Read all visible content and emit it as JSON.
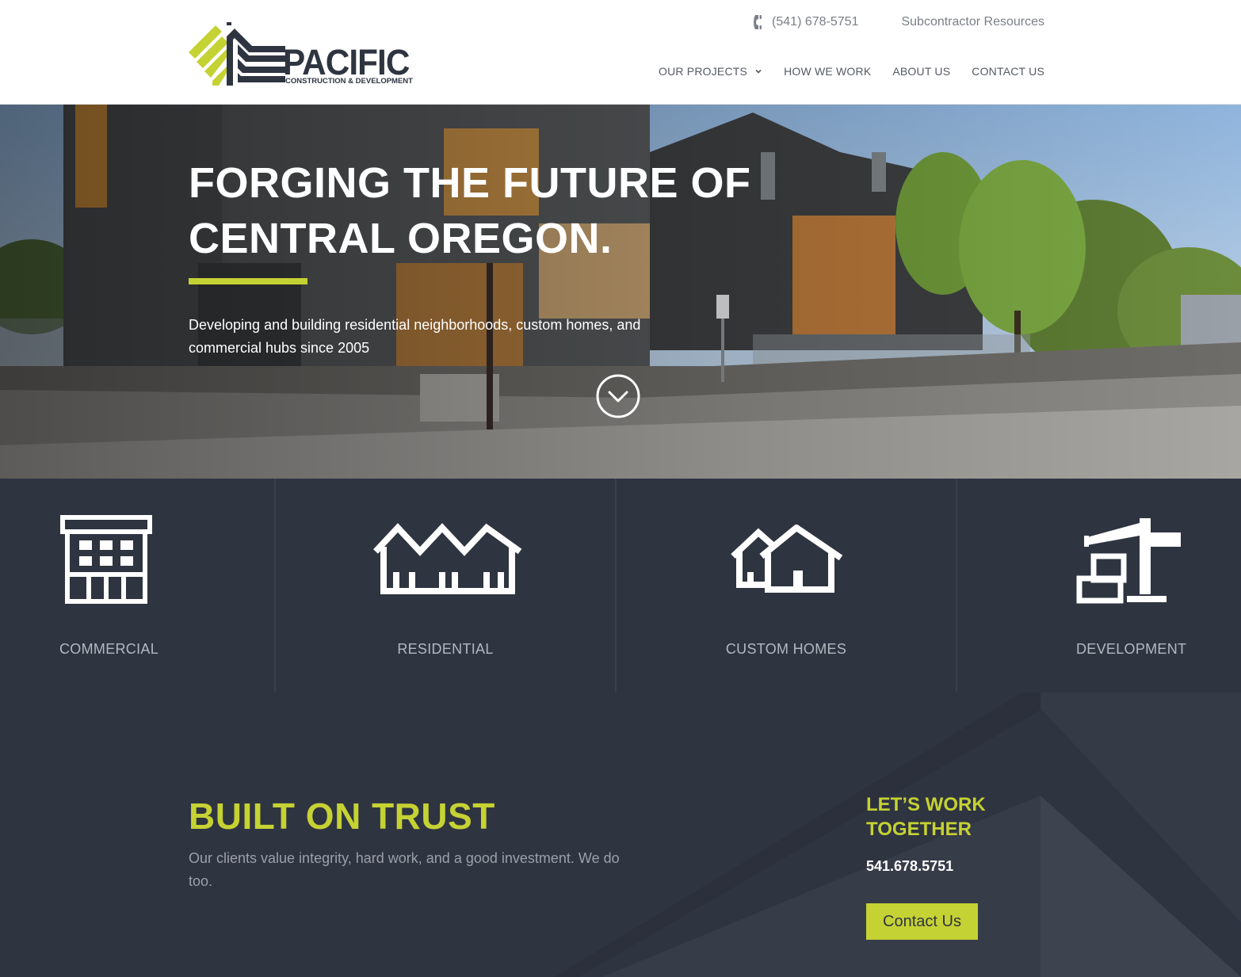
{
  "brand": {
    "name": "PACIFIC",
    "tagline": "CONSTRUCTION & DEVELOPMENT",
    "accent_color": "#c5d233",
    "dark_color": "#2f3441"
  },
  "topbar": {
    "phone_icon": "phone-icon",
    "phone": "(541) 678-5751",
    "subcontractor_link": "Subcontractor Resources"
  },
  "nav": {
    "items": [
      {
        "label": "OUR PROJECTS",
        "has_dropdown": true
      },
      {
        "label": "HOW WE WORK"
      },
      {
        "label": "ABOUT US"
      },
      {
        "label": "CONTACT US"
      }
    ]
  },
  "hero": {
    "title_line1": "FORGING THE FUTURE OF",
    "title_line2": "CENTRAL OREGON.",
    "subtitle": "Developing and building residential neighborhoods, custom homes, and commercial hubs since 2005",
    "scroll_icon": "chevron-down-circle-icon"
  },
  "services": [
    {
      "label": "COMMERCIAL",
      "icon": "commercial-building-icon"
    },
    {
      "label": "RESIDENTIAL",
      "icon": "row-houses-icon"
    },
    {
      "label": "CUSTOM HOMES",
      "icon": "houses-icon"
    },
    {
      "label": "DEVELOPMENT",
      "icon": "crane-icon"
    }
  ],
  "trust": {
    "title": "BUILT ON TRUST",
    "text": "Our clients value integrity, hard work, and a good investment. We do too."
  },
  "cta": {
    "title": "LET’S WORK TOGETHER",
    "phone": "541.678.5751",
    "button_label": "Contact Us"
  }
}
